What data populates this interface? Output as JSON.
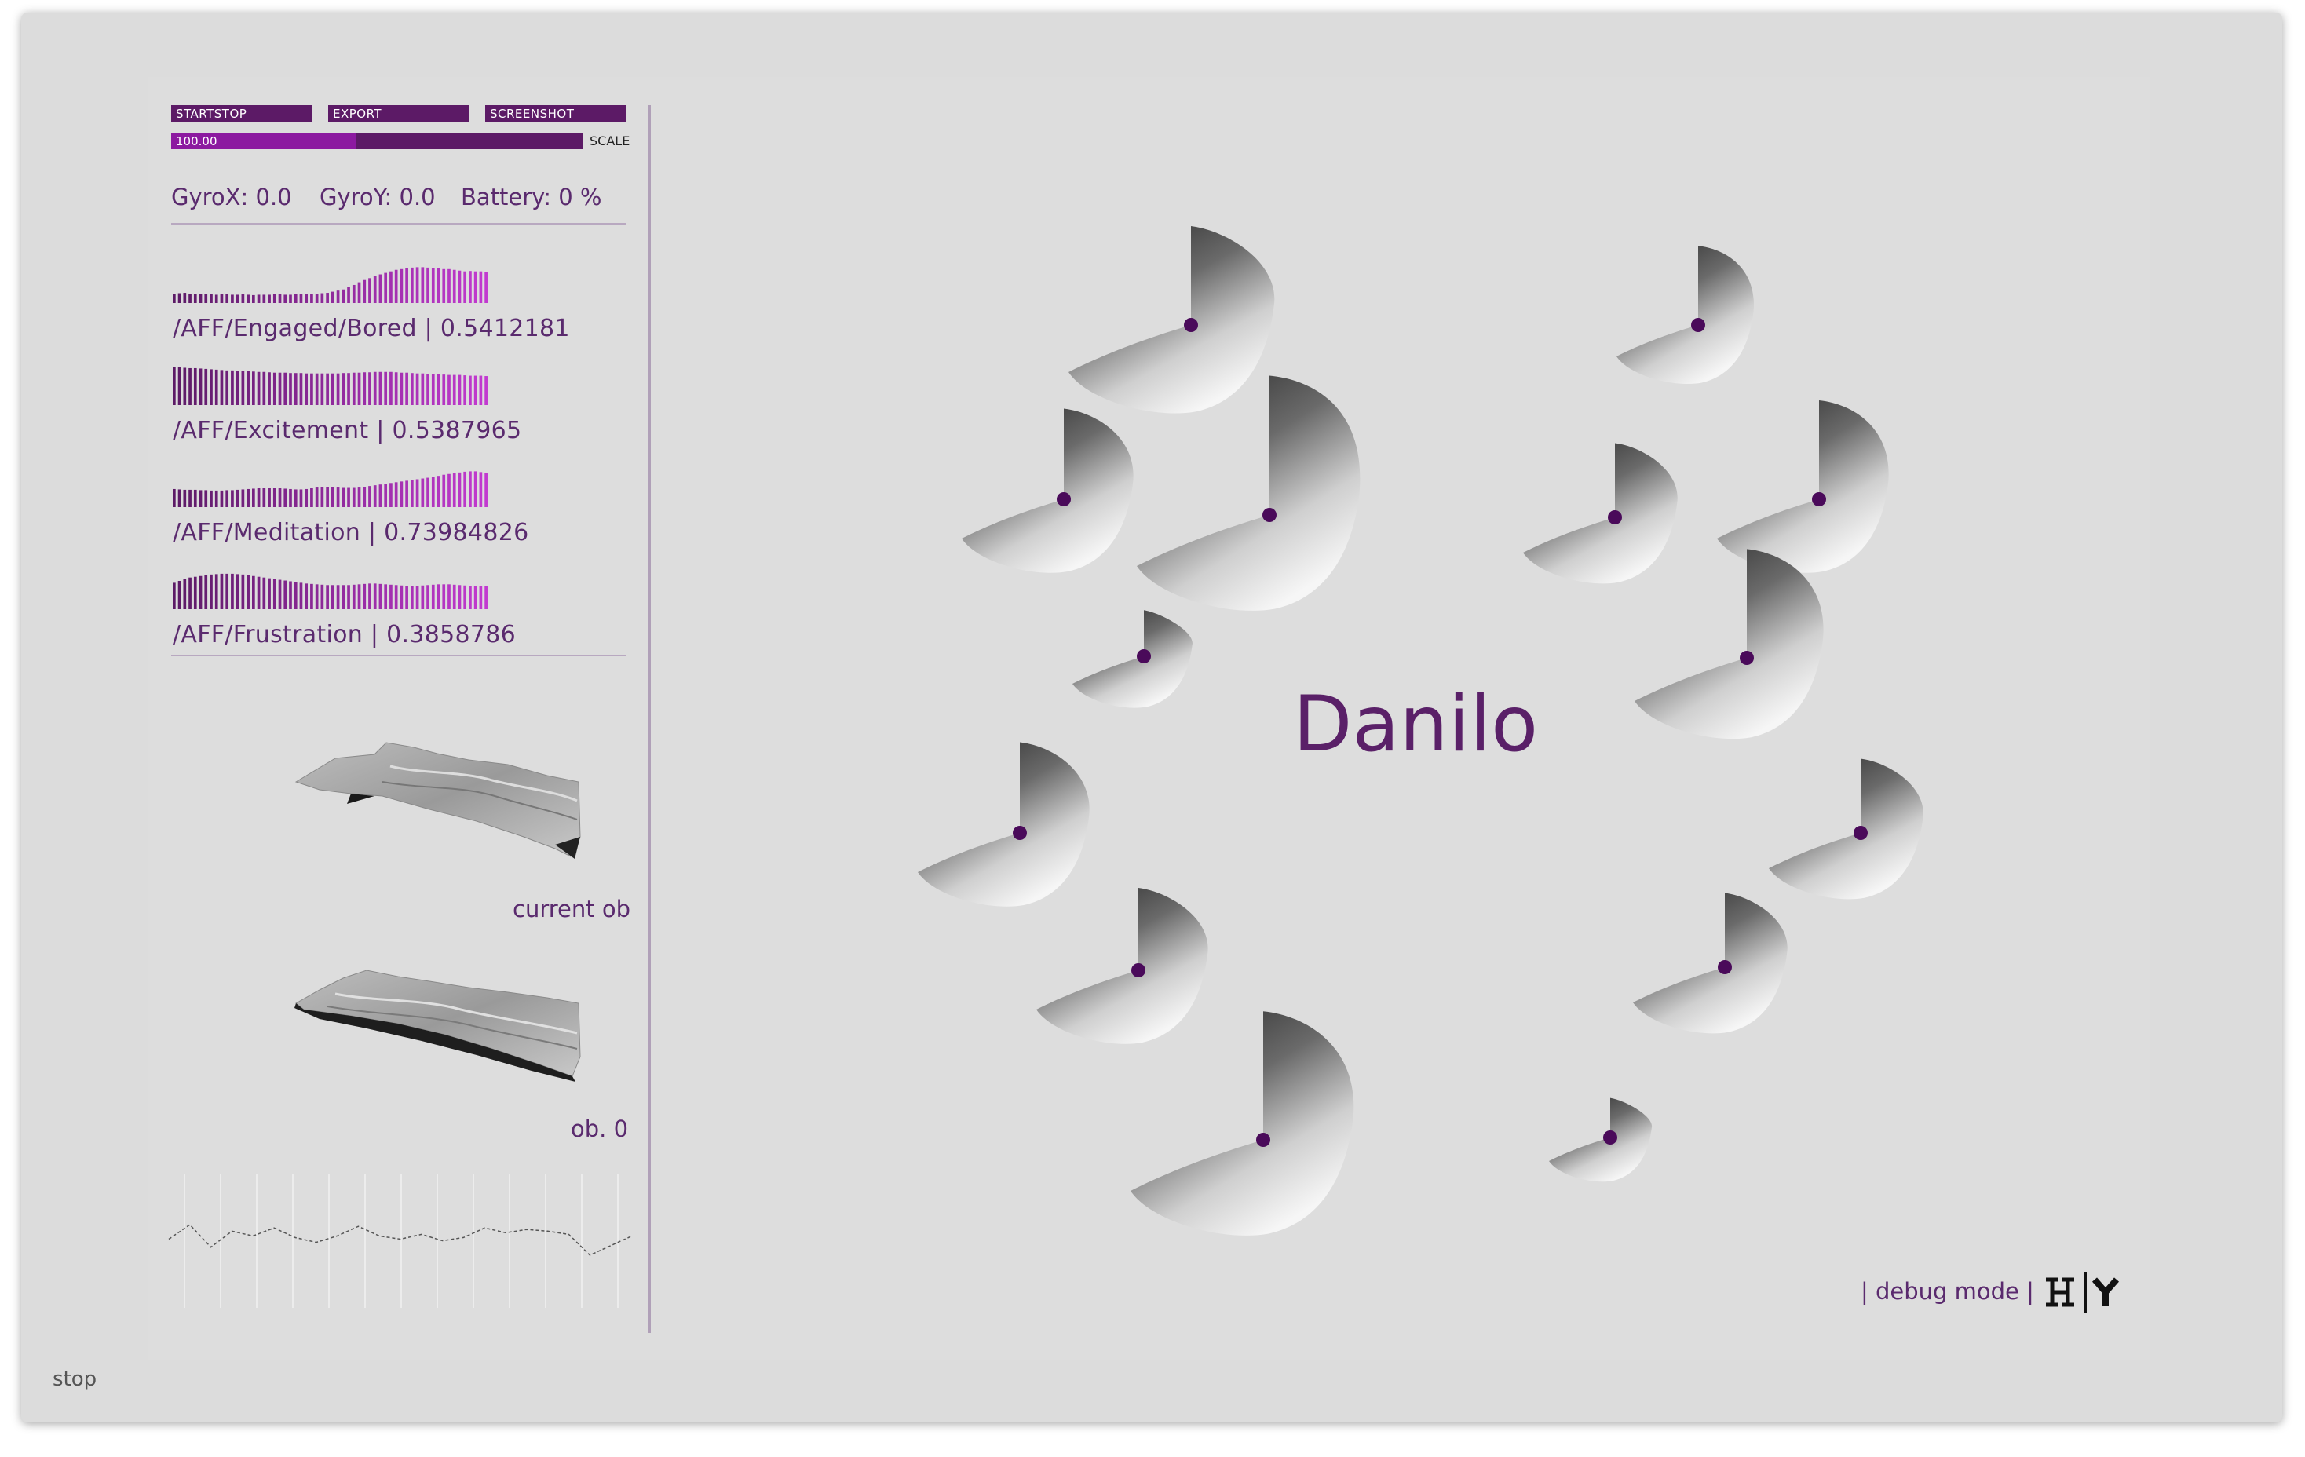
{
  "controls": {
    "buttons": [
      "STARTSTOP",
      "EXPORT",
      "SCREENSHOT"
    ],
    "scale": {
      "value_text": "100.00",
      "label": "SCALE",
      "fill_fraction": 0.45
    }
  },
  "status": {
    "gyro_x": "GyroX: 0.0",
    "gyro_y": "GyroY: 0.0",
    "battery": "Battery: 0 %"
  },
  "affect_channels": [
    {
      "label": "/AFF/Engaged/Bored | 0.5412181",
      "history": [
        0.25,
        0.26,
        0.27,
        0.25,
        0.24,
        0.24,
        0.23,
        0.24,
        0.22,
        0.23,
        0.23,
        0.22,
        0.22,
        0.23,
        0.22,
        0.21,
        0.22,
        0.22,
        0.22,
        0.23,
        0.23,
        0.22,
        0.22,
        0.23,
        0.23,
        0.24,
        0.24,
        0.24,
        0.26,
        0.27,
        0.3,
        0.33,
        0.36,
        0.42,
        0.48,
        0.55,
        0.61,
        0.66,
        0.72,
        0.76,
        0.8,
        0.84,
        0.88,
        0.9,
        0.92,
        0.94,
        0.95,
        0.95,
        0.94,
        0.93,
        0.92,
        0.9,
        0.9,
        0.88,
        0.86,
        0.84,
        0.85,
        0.84,
        0.84,
        0.83
      ]
    },
    {
      "label": "/AFF/Excitement | 0.5387965",
      "history": [
        1.0,
        1.0,
        0.99,
        0.98,
        0.98,
        0.97,
        0.96,
        0.95,
        0.94,
        0.93,
        0.92,
        0.92,
        0.91,
        0.9,
        0.9,
        0.89,
        0.88,
        0.88,
        0.87,
        0.86,
        0.86,
        0.86,
        0.85,
        0.85,
        0.85,
        0.84,
        0.84,
        0.84,
        0.84,
        0.84,
        0.84,
        0.84,
        0.85,
        0.85,
        0.86,
        0.86,
        0.87,
        0.87,
        0.88,
        0.88,
        0.88,
        0.88,
        0.87,
        0.86,
        0.86,
        0.85,
        0.84,
        0.84,
        0.83,
        0.82,
        0.82,
        0.81,
        0.8,
        0.8,
        0.8,
        0.79,
        0.78,
        0.78,
        0.78,
        0.77
      ]
    },
    {
      "label": "/AFF/Meditation | 0.73984826",
      "history": [
        0.48,
        0.47,
        0.46,
        0.46,
        0.46,
        0.45,
        0.45,
        0.44,
        0.44,
        0.44,
        0.45,
        0.45,
        0.46,
        0.47,
        0.48,
        0.49,
        0.5,
        0.5,
        0.5,
        0.5,
        0.5,
        0.49,
        0.48,
        0.47,
        0.47,
        0.48,
        0.5,
        0.52,
        0.53,
        0.53,
        0.53,
        0.52,
        0.51,
        0.51,
        0.51,
        0.52,
        0.54,
        0.56,
        0.58,
        0.6,
        0.62,
        0.64,
        0.66,
        0.68,
        0.7,
        0.72,
        0.74,
        0.76,
        0.78,
        0.8,
        0.83,
        0.86,
        0.88,
        0.9,
        0.92,
        0.94,
        0.95,
        0.95,
        0.93,
        0.9
      ]
    },
    {
      "label": "/AFF/Frustration | 0.3858786",
      "history": [
        0.7,
        0.75,
        0.8,
        0.84,
        0.86,
        0.88,
        0.9,
        0.92,
        0.93,
        0.94,
        0.94,
        0.94,
        0.93,
        0.92,
        0.9,
        0.88,
        0.86,
        0.84,
        0.82,
        0.8,
        0.78,
        0.76,
        0.74,
        0.72,
        0.7,
        0.68,
        0.67,
        0.66,
        0.65,
        0.64,
        0.64,
        0.64,
        0.64,
        0.64,
        0.65,
        0.66,
        0.67,
        0.68,
        0.68,
        0.67,
        0.66,
        0.65,
        0.64,
        0.63,
        0.62,
        0.62,
        0.62,
        0.63,
        0.64,
        0.65,
        0.66,
        0.66,
        0.66,
        0.65,
        0.64,
        0.63,
        0.62,
        0.62,
        0.62,
        0.62
      ]
    }
  ],
  "surfaces": [
    {
      "label": "current ob"
    },
    {
      "label": "ob. 0"
    }
  ],
  "trace": {
    "values": [
      0.38,
      0.47,
      0.33,
      0.43,
      0.4,
      0.45,
      0.39,
      0.36,
      0.4,
      0.46,
      0.4,
      0.38,
      0.41,
      0.37,
      0.39,
      0.45,
      0.42,
      0.44,
      0.43,
      0.41,
      0.28,
      0.34,
      0.4
    ]
  },
  "main": {
    "title": "Danilo",
    "debug_text": "| debug mode |"
  },
  "footer": {
    "status": "stop"
  },
  "colors": {
    "accent": "#5c1a66",
    "accent_bright": "#8c1aa0",
    "text_purple": "#5a2a6e",
    "node": "#4a0a5a",
    "background": "#dddddd"
  }
}
